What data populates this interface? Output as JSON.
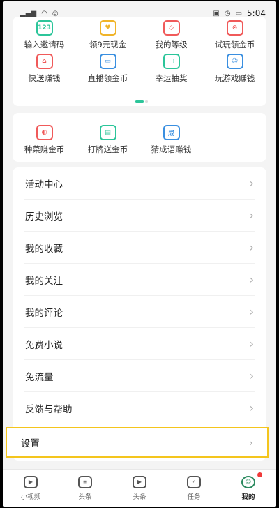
{
  "status_bar": {
    "left_icons": [
      "signal-icon",
      "wifi-icon",
      "hotspot-icon"
    ],
    "right_icons": [
      "hd-icon",
      "alarm-icon",
      "battery-icon"
    ],
    "time": "5:04"
  },
  "grid": {
    "rows": [
      [
        {
          "label": "输入邀请码",
          "icon": "code-icon",
          "color": "#2cc59a",
          "glyph": "123"
        },
        {
          "label": "领9元现金",
          "icon": "heart-coin-icon",
          "color": "#f0b429",
          "glyph": "♥"
        },
        {
          "label": "我的等级",
          "icon": "diamond-icon",
          "color": "#f05a5a",
          "glyph": "◇"
        },
        {
          "label": "试玩领金币",
          "icon": "robot-icon",
          "color": "#f05a5a",
          "glyph": "⊙"
        }
      ],
      [
        {
          "label": "快送赚钱",
          "icon": "bag-icon",
          "color": "#f05a5a",
          "glyph": "⌂"
        },
        {
          "label": "直播领金币",
          "icon": "tv-icon",
          "color": "#3a8fe0",
          "glyph": "▭"
        },
        {
          "label": "幸运抽奖",
          "icon": "lottery-icon",
          "color": "#2cc59a",
          "glyph": "▢"
        },
        {
          "label": "玩游戏赚钱",
          "icon": "game-icon",
          "color": "#3a8fe0",
          "glyph": "☺"
        }
      ]
    ],
    "row2": [
      {
        "label": "种菜赚金币",
        "icon": "farm-icon",
        "color": "#f05a5a",
        "glyph": "◐"
      },
      {
        "label": "打牌送金币",
        "icon": "cards-icon",
        "color": "#2cc59a",
        "glyph": "▤"
      },
      {
        "label": "猜成语赚钱",
        "icon": "idiom-icon",
        "color": "#3a8fe0",
        "glyph": "成"
      }
    ]
  },
  "menu": {
    "items": [
      "活动中心",
      "历史浏览",
      "我的收藏",
      "我的关注",
      "我的评论",
      "免费小说",
      "免流量",
      "反馈与帮助"
    ],
    "settings_label": "设置",
    "chevron": "›"
  },
  "tabbar": {
    "tabs": [
      {
        "label": "小视频",
        "icon": "video-icon",
        "glyph": "▶"
      },
      {
        "label": "头条",
        "icon": "news-icon",
        "glyph": "≡"
      },
      {
        "label": "头条",
        "icon": "play-icon",
        "glyph": "▶"
      },
      {
        "label": "任务",
        "icon": "task-icon",
        "glyph": "✓"
      },
      {
        "label": "我的",
        "icon": "profile-icon",
        "glyph": "☺",
        "active": true
      }
    ]
  }
}
